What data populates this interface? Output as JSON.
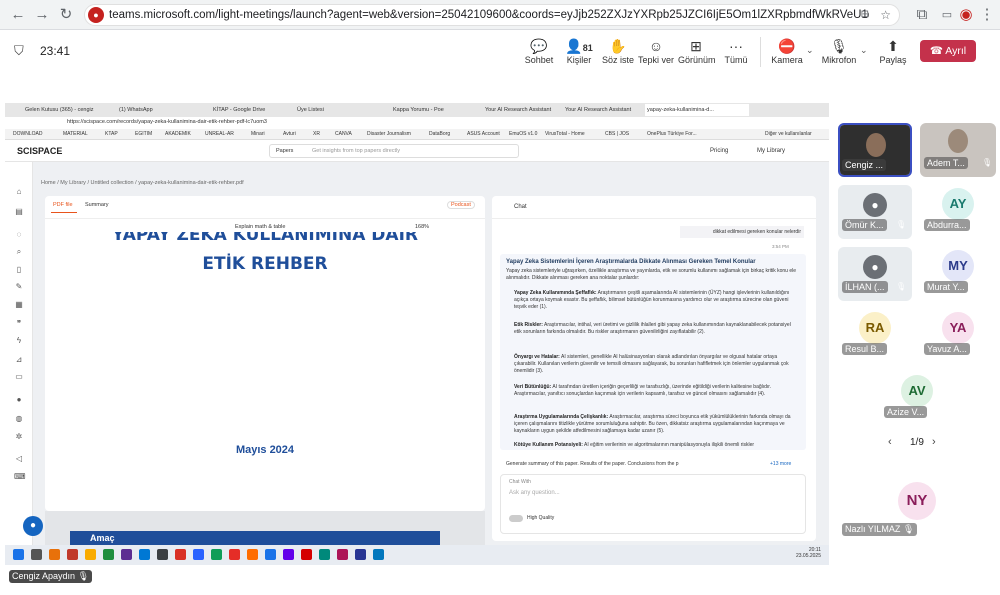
{
  "browser": {
    "url": "teams.microsoft.com/light-meetings/launch?agent=web&version=25042109600&coords=eyJjb252ZXJzYXRpb25JZCI6IjE5Om1lZXRpbmdfWkRVeU1qUTNPRFF..."
  },
  "toolbar": {
    "time": "23:41",
    "chat": "Sohbet",
    "people": "Kişiler",
    "people_count": "81",
    "raise": "Söz iste",
    "react": "Tepki ver",
    "view": "Görünüm",
    "more": "Tümü",
    "camera": "Kamera",
    "mic": "Mikrofon",
    "share": "Paylaş",
    "leave": "Ayrıl"
  },
  "shared": {
    "tabs": [
      "Gelen Kutusu (365) - cengiz",
      "(1) WhatsApp",
      "KİTAP - Google Drive",
      "Üye Listesi",
      "Kappa Yorumu - Poe",
      "Your AI Research Assistant",
      "Your AI Research Assistant",
      "yapay-zeka-kullanimina-d..."
    ],
    "address": "https://scispace.com/records/yapay-zeka-kullanimina-dair-etik-rehber-pdf-lc7uom3",
    "bookmarks": [
      "DOWNLOAD",
      "MATERIAL",
      "KTAP",
      "EGITIM",
      "AKADEMIK",
      "UNREAL-AR",
      "Minari",
      "Avturi",
      "XR",
      "CANVA",
      "Disaster Journalism",
      "DataBorg",
      "ASUS Account",
      "EmuOS v1.0",
      "VirusTotal - Home",
      "CBS | JOS",
      "OnePlus Türkiye For...",
      "Diğer ve kullanılanlar"
    ],
    "logo": "SCISPACE",
    "papers": "Papers",
    "search_placeholder": "Get insights from top papers directly",
    "pricing": "Pricing",
    "my_library": "My Library",
    "breadcrumb": "Home  /  My Library  /  Untitled collection  /  yapay-zeka-kullanimina-dair-etik-rehber.pdf",
    "tab_pdf": "PDF file",
    "tab_summary": "Summary",
    "podcast": "Podcast",
    "explain": "Explain math & table",
    "zoom": "168%",
    "pdf_title_1": "YAPAY ZEKA KULLANIMINA DAİR",
    "pdf_title_2": "ETİK REHBER",
    "pdf_date": "Mayıs 2024",
    "pdf_next": "Amaç",
    "chat_title": "Chat",
    "user_msg": "dikkat edilmesi gereken konular nelerdir",
    "user_time": "3:54 PM",
    "answer_title": "Yapay Zeka Sistemlerini İçeren Araştırmalarda Dikkate Alınması Gereken Temel Konular",
    "answer_intro": "Yapay zeka sistemleriyle uğraşırken, özellikle araştırma ve yayınlarda, etik ve sorumlu kullanımı sağlamak için birkaç kritik konu ele alınmalıdır. Dikkate alınması gereken ana noktalar şunlardır:",
    "bullets": [
      {
        "t": "Yapay Zeka Kullanımında Şeffaflık:",
        "d": "Araştırmanın çeşitli aşamalarında AI sistemlerinin (ÜYZ) hangi işlevlerinin kullanıldığını açıkça ortaya koymak esastır. Bu şeffaflık, bilimsel bütünlüğün korunmasına yardımcı olur ve araştırma sürecine olan güveni teşvik eder (1)."
      },
      {
        "t": "Etik Riskler:",
        "d": "Araştırmacılar, intihal, veri üretimi ve gizlilik ihlalleri gibi yapay zeka kullanımından kaynaklanabilecek potansiyel etik sorunların farkında olmalıdır. Bu riskler araştırmanın güvenilirliğini zayıflatabilir (2)."
      },
      {
        "t": "Önyargı ve Hatalar:",
        "d": "AI sistemleri, genellikle AI halüsinasyonları olarak adlandırılan önyargılar ve olgusal hatalar ortaya çıkarabilir. Kullanılan verilerin güvenilir ve temsili olmasını sağlayarak, bu sorunları hafifletmek için önlemler uygulanmak çok önemlidir (3)."
      },
      {
        "t": "Veri Bütünlüğü:",
        "d": "AI tarafından üretilen içeriğin geçerliliği ve tarafsızlığı, üzerinde eğitildiği verilerin kalitesine bağlıdır. Araştırmacılar, yanıltıcı sonuçlardan kaçınmak için verilerin kapsamlı, tarafsız ve güncel olmasını sağlamalıdır (4)."
      },
      {
        "t": "Araştırma Uygulamalarında Çelişkanlık:",
        "d": "Araştırmacılar, araştırma süreci boyunca etik yükümlülüklerinin farkında olmayı da içeren çalışmalarını titizlikle yürütme sorumluluğuna sahiptir. Bu özen, dikkatsiz araştırma uygulamalarından kaçınmaya ve kaynakların uygun şekilde atfedilmesini sağlamaya kadar uzanır (5)."
      },
      {
        "t": "Kötüye Kullanım Potansiyeli:",
        "d": "AI eğitim verilerinin ve algoritmalarının manipülasyonuyla ilişkili önemli riskler"
      }
    ],
    "generate": "Generate summary of this paper. Results of the paper. Conclusions from the p",
    "more_count": "+13 more",
    "chat_with": "Chat With",
    "ask_placeholder": "Ask any question...",
    "high_quality": "High Quality",
    "clock_time": "20:11",
    "clock_date": "23.05.2025"
  },
  "participants": [
    {
      "name": "Cengiz ...",
      "initials": "",
      "bg": "#3a3a3a"
    },
    {
      "name": "Adem T...",
      "initials": "",
      "bg": "#c9c4bf"
    },
    {
      "name": "Ömür K...",
      "initials": "",
      "bg": "#e8ecef"
    },
    {
      "name": "Abdurra...",
      "initials": "AY",
      "bg": "#d9f2ef"
    },
    {
      "name": "İLHAN (...",
      "initials": "",
      "bg": "#e8ecef"
    },
    {
      "name": "Murat Y...",
      "initials": "MY",
      "bg": "#e3e6f8"
    },
    {
      "name": "Resul B...",
      "initials": "RA",
      "bg": "#fbf0c8"
    },
    {
      "name": "Yavuz A...",
      "initials": "YA",
      "bg": "#f8e1ee"
    },
    {
      "name": "Azize V...",
      "initials": "AV",
      "bg": "#ddf1e2"
    },
    {
      "name": "Nazlı YILMAZ",
      "initials": "NY",
      "bg": "#f8e1ee"
    }
  ],
  "pager": "1/9",
  "presenter": "Cengiz Apaydın"
}
